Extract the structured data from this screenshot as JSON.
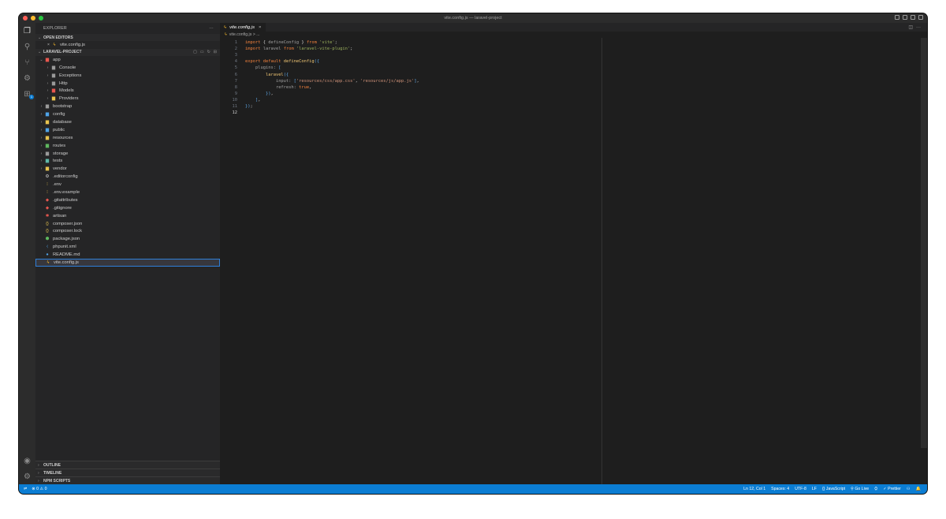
{
  "window": {
    "title": "vite.config.js — laravel-project",
    "colors": {
      "close": "#ff5f57",
      "minimize": "#febc2e",
      "zoom": "#28c840"
    }
  },
  "sidebar": {
    "header": "EXPLORER",
    "header_more": "···",
    "open_editors": {
      "label": "OPEN EDITORS",
      "file": "vite.config.js"
    },
    "project": {
      "label": "LARAVEL-PROJECT"
    },
    "tree": [
      {
        "label": "app",
        "depth": 0,
        "twisty": "v",
        "icon": "▆",
        "color": "#e8574f"
      },
      {
        "label": "Console",
        "depth": 1,
        "twisty": ">",
        "icon": "▆",
        "color": "#9a9a9a"
      },
      {
        "label": "Exceptions",
        "depth": 1,
        "twisty": ">",
        "icon": "▆",
        "color": "#9a9a9a"
      },
      {
        "label": "Http",
        "depth": 1,
        "twisty": ">",
        "icon": "▆",
        "color": "#9a9a9a"
      },
      {
        "label": "Models",
        "depth": 1,
        "twisty": ">",
        "icon": "▆",
        "color": "#e8574f"
      },
      {
        "label": "Providers",
        "depth": 1,
        "twisty": ">",
        "icon": "▆",
        "color": "#e8c44f"
      },
      {
        "label": "bootstrap",
        "depth": 0,
        "twisty": ">",
        "icon": "▆",
        "color": "#9a9a9a"
      },
      {
        "label": "config",
        "depth": 0,
        "twisty": ">",
        "icon": "▆",
        "color": "#4fa3e8"
      },
      {
        "label": "database",
        "depth": 0,
        "twisty": ">",
        "icon": "▆",
        "color": "#e8c44f"
      },
      {
        "label": "public",
        "depth": 0,
        "twisty": ">",
        "icon": "▆",
        "color": "#4fa3e8"
      },
      {
        "label": "resources",
        "depth": 0,
        "twisty": ">",
        "icon": "▆",
        "color": "#e8c44f"
      },
      {
        "label": "routes",
        "depth": 0,
        "twisty": ">",
        "icon": "▆",
        "color": "#5fb85f"
      },
      {
        "label": "storage",
        "depth": 0,
        "twisty": ">",
        "icon": "▆",
        "color": "#9a9a9a"
      },
      {
        "label": "tests",
        "depth": 0,
        "twisty": ">",
        "icon": "▆",
        "color": "#5fb8a8"
      },
      {
        "label": "vendor",
        "depth": 0,
        "twisty": ">",
        "icon": "▆",
        "color": "#e8c44f"
      },
      {
        "label": ".editorconfig",
        "depth": 0,
        "twisty": "",
        "icon": "⚙",
        "color": "#d0d0d0"
      },
      {
        "label": ".env",
        "depth": 0,
        "twisty": "",
        "icon": "⁝",
        "color": "#e8c44f"
      },
      {
        "label": ".env.example",
        "depth": 0,
        "twisty": "",
        "icon": "⁝",
        "color": "#e8c44f"
      },
      {
        "label": ".gitattributes",
        "depth": 0,
        "twisty": "",
        "icon": "◆",
        "color": "#e8574f"
      },
      {
        "label": ".gitignore",
        "depth": 0,
        "twisty": "",
        "icon": "◆",
        "color": "#e8574f"
      },
      {
        "label": "artisan",
        "depth": 0,
        "twisty": "",
        "icon": "✱",
        "color": "#e8574f"
      },
      {
        "label": "composer.json",
        "depth": 0,
        "twisty": "",
        "icon": "{}",
        "color": "#e8c44f"
      },
      {
        "label": "composer.lock",
        "depth": 0,
        "twisty": "",
        "icon": "{}",
        "color": "#e8c44f"
      },
      {
        "label": "package.json",
        "depth": 0,
        "twisty": "",
        "icon": "⬢",
        "color": "#5fb85f"
      },
      {
        "label": "phpunit.xml",
        "depth": 0,
        "twisty": "",
        "icon": "⧼",
        "color": "#4fa3e8"
      },
      {
        "label": "README.md",
        "depth": 0,
        "twisty": "",
        "icon": "●",
        "color": "#4fa3e8"
      },
      {
        "label": "vite.config.js",
        "depth": 0,
        "twisty": "",
        "icon": "ϟ",
        "color": "#f0b429",
        "selected": true
      }
    ],
    "bottom": [
      "OUTLINE",
      "TIMELINE",
      "NPM SCRIPTS"
    ]
  },
  "editor": {
    "tab_label": "vite.config.js",
    "tab_close": "×",
    "breadcrumb": "vite.config.js > ...",
    "actions_more": "···"
  },
  "code": [
    [
      [
        "kw2",
        "import"
      ],
      [
        "punc",
        " { "
      ],
      [
        "prop",
        "defineConfig"
      ],
      [
        "punc",
        " } "
      ],
      [
        "kw2",
        "from"
      ],
      [
        "str2",
        " 'vite'"
      ],
      [
        "punc",
        ";"
      ]
    ],
    [
      [
        "kw2",
        "import"
      ],
      [
        "prop",
        " laravel "
      ],
      [
        "kw2",
        "from"
      ],
      [
        "str2",
        " 'laravel-vite-plugin'"
      ],
      [
        "punc",
        ";"
      ]
    ],
    [],
    [
      [
        "kw2",
        "export"
      ],
      [
        "kw2",
        " default"
      ],
      [
        "fn",
        " defineConfig"
      ],
      [
        "br",
        "({"
      ]
    ],
    [
      [
        "prop",
        "    plugins: "
      ],
      [
        "br",
        "["
      ]
    ],
    [
      [
        "fn",
        "        laravel"
      ],
      [
        "br",
        "({"
      ]
    ],
    [
      [
        "prop",
        "            input: "
      ],
      [
        "br",
        "["
      ],
      [
        "str",
        "'resources/css/app.css'"
      ],
      [
        "punc",
        ", "
      ],
      [
        "str",
        "'resources/js/app.js'"
      ],
      [
        "br",
        "]"
      ],
      [
        "punc",
        ","
      ]
    ],
    [
      [
        "prop",
        "            refresh: "
      ],
      [
        "bool",
        "true"
      ],
      [
        "punc",
        ","
      ]
    ],
    [
      [
        "br",
        "        })"
      ],
      [
        "punc",
        ","
      ]
    ],
    [
      [
        "br",
        "    ]"
      ],
      [
        "punc",
        ","
      ]
    ],
    [
      [
        "br",
        "})"
      ],
      [
        "punc",
        ";"
      ]
    ],
    []
  ],
  "status": {
    "problems": "⊗ 0 ⚠ 0",
    "items": [
      "Ln 12, Col 1",
      "Spaces: 4",
      "UTF-8",
      "LF",
      "{} JavaScript",
      "⚲ Go Live",
      "⛭",
      "✓ Prettier",
      "⚇",
      "🔔"
    ]
  }
}
